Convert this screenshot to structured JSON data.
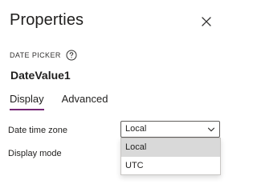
{
  "panel": {
    "title": "Properties",
    "close_icon": "close-icon"
  },
  "control": {
    "kind": "DATE PICKER",
    "help_icon": "help-circle-icon",
    "name": "DateValue1"
  },
  "tabs": [
    {
      "label": "Display",
      "active": true
    },
    {
      "label": "Advanced",
      "active": false
    }
  ],
  "properties": {
    "time_zone": {
      "label": "Date time zone",
      "value": "Local",
      "chevron_icon": "chevron-down-icon",
      "options": [
        {
          "label": "Local",
          "highlighted": true
        },
        {
          "label": "UTC",
          "highlighted": false
        }
      ]
    },
    "display_mode": {
      "label": "Display mode"
    }
  },
  "colors": {
    "tab_underline": "#742774",
    "option_highlight": "#d9d9d9",
    "text": "#201f1e"
  }
}
